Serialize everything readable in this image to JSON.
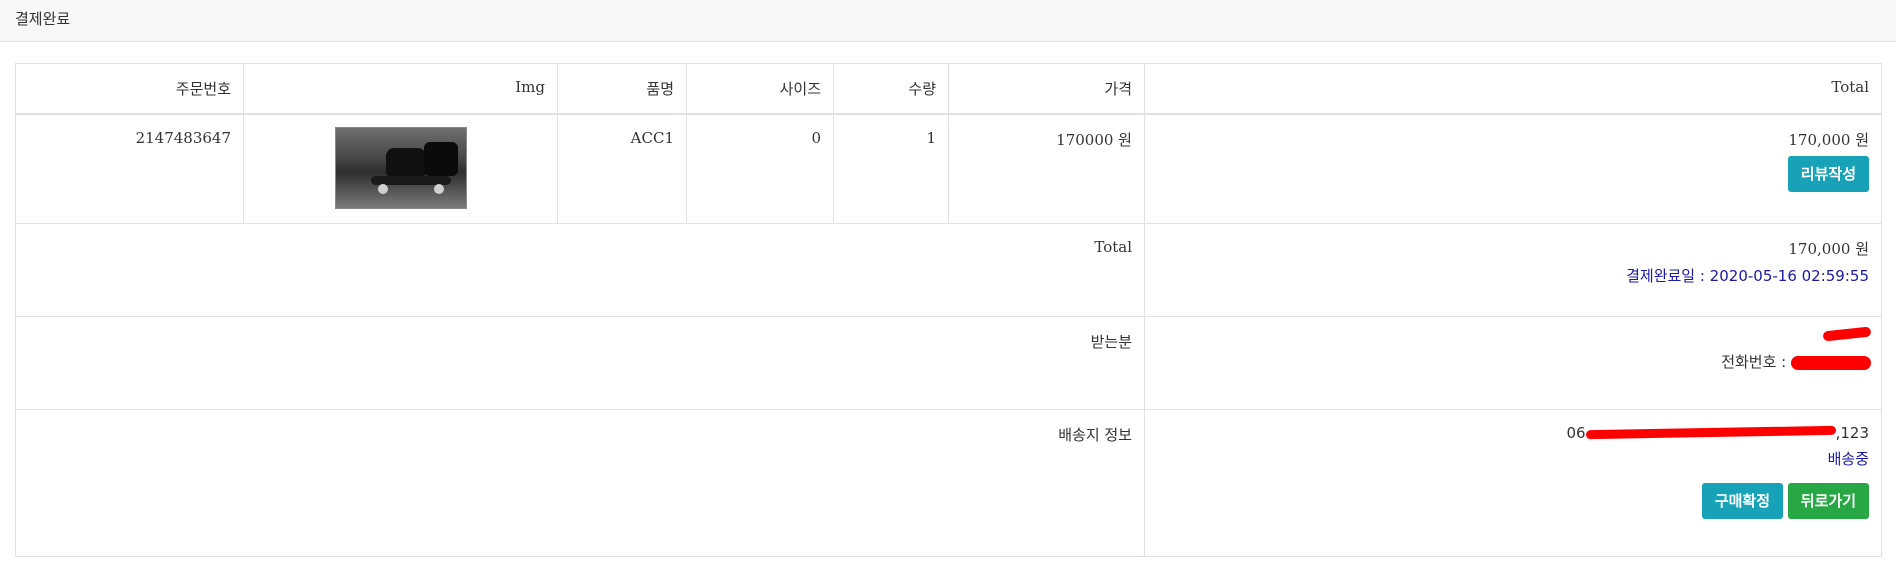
{
  "header": {
    "title": "결제완료"
  },
  "table": {
    "columns": [
      "주문번호",
      "Img",
      "품명",
      "사이즈",
      "수량",
      "가격",
      "Total"
    ],
    "item": {
      "order_no": "2147483647",
      "name": "ACC1",
      "size": "0",
      "qty": "1",
      "price": "170000 원",
      "total": "170,000 원",
      "review_button": "리뷰작성"
    },
    "summary": {
      "label": "Total",
      "total": "170,000 원",
      "paid_date": "결제완료일 : 2020-05-16 02:59:55"
    },
    "recipient": {
      "label": "받는분",
      "phone_label": "전화번호 : "
    },
    "shipping": {
      "label": "배송지 정보",
      "address_prefix": "06",
      "address_suffix": ",123",
      "status": "배송중",
      "confirm_button": "구매확정",
      "back_button": "뒤로가기"
    }
  },
  "colors": {
    "info": "#17a2b8",
    "success": "#28a745",
    "link_blue": "#1a1aa6",
    "redaction": "#ff0000"
  },
  "icons": {
    "product_image": "skateboard-photo"
  }
}
